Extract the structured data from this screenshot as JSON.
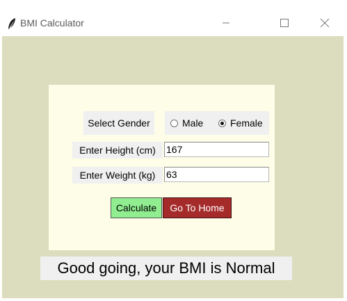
{
  "window": {
    "title": "BMI Calculator",
    "app_icon": "feather-icon",
    "controls": {
      "minimize_icon": "minimize-icon",
      "maximize_icon": "maximize-icon",
      "close_icon": "close-icon"
    }
  },
  "form": {
    "gender_label": "Select Gender",
    "gender_options": [
      {
        "label": "Male",
        "selected": false
      },
      {
        "label": "Female",
        "selected": true
      }
    ],
    "height_label": "Enter Height (cm)",
    "height_value": "167",
    "weight_label": "Enter Weight (kg)",
    "weight_value": "63"
  },
  "buttons": {
    "calculate": "Calculate",
    "home": "Go To Home"
  },
  "result": "Good going, your BMI is Normal",
  "colors": {
    "background": "#dcdcbe",
    "panel": "#fdfde8",
    "calculate_button": "#90ee90",
    "home_button": "#a52a2a"
  }
}
